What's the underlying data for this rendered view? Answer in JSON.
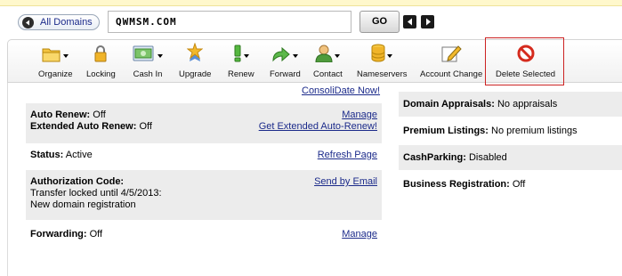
{
  "top": {
    "all_domains_label": "All Domains",
    "domain_value": "QWMSM.COM",
    "go_label": "GO"
  },
  "toolbar": {
    "items": [
      {
        "label": "Organize",
        "icon": "folder-icon",
        "dropdown": true
      },
      {
        "label": "Locking",
        "icon": "padlock-icon",
        "dropdown": false
      },
      {
        "label": "Cash In",
        "icon": "cash-in-icon",
        "dropdown": true
      },
      {
        "label": "Upgrade",
        "icon": "star-ribbon-icon",
        "dropdown": false
      },
      {
        "label": "Renew",
        "icon": "renew-icon",
        "dropdown": true
      },
      {
        "label": "Forward",
        "icon": "forward-arrow-icon",
        "dropdown": true
      },
      {
        "label": "Contact",
        "icon": "contact-person-icon",
        "dropdown": true
      },
      {
        "label": "Nameservers",
        "icon": "nameservers-database-icon",
        "dropdown": true
      },
      {
        "label": "Account Change",
        "icon": "account-change-pencil-icon",
        "dropdown": false
      },
      {
        "label": "Delete Selected",
        "icon": "prohibited-icon",
        "dropdown": false
      }
    ]
  },
  "left": {
    "consolidate_link": "ConsoliDate Now!",
    "auto_renew_label": "Auto Renew:",
    "auto_renew_value": "Off",
    "auto_renew_link": "Manage",
    "ext_auto_renew_label": "Extended Auto Renew:",
    "ext_auto_renew_value": "Off",
    "ext_auto_renew_link": "Get Extended Auto-Renew!",
    "status_label": "Status:",
    "status_value": "Active",
    "status_link": "Refresh Page",
    "auth_label": "Authorization Code:",
    "auth_link": "Send by Email",
    "auth_line1": "Transfer locked until 4/5/2013:",
    "auth_line2": "New domain registration",
    "forwarding_label": "Forwarding:",
    "forwarding_value": "Off",
    "forwarding_link": "Manage"
  },
  "right": {
    "appraisals_label": "Domain Appraisals:",
    "appraisals_value": "No appraisals",
    "premium_label": "Premium Listings:",
    "premium_value": "No premium listings",
    "cashparking_label": "CashParking:",
    "cashparking_value": "Disabled",
    "business_label": "Business Registration:",
    "business_value": "Off"
  },
  "colors": {
    "link": "#1b2a8a",
    "shade": "#ececec",
    "highlight_box": "#cc2222"
  }
}
